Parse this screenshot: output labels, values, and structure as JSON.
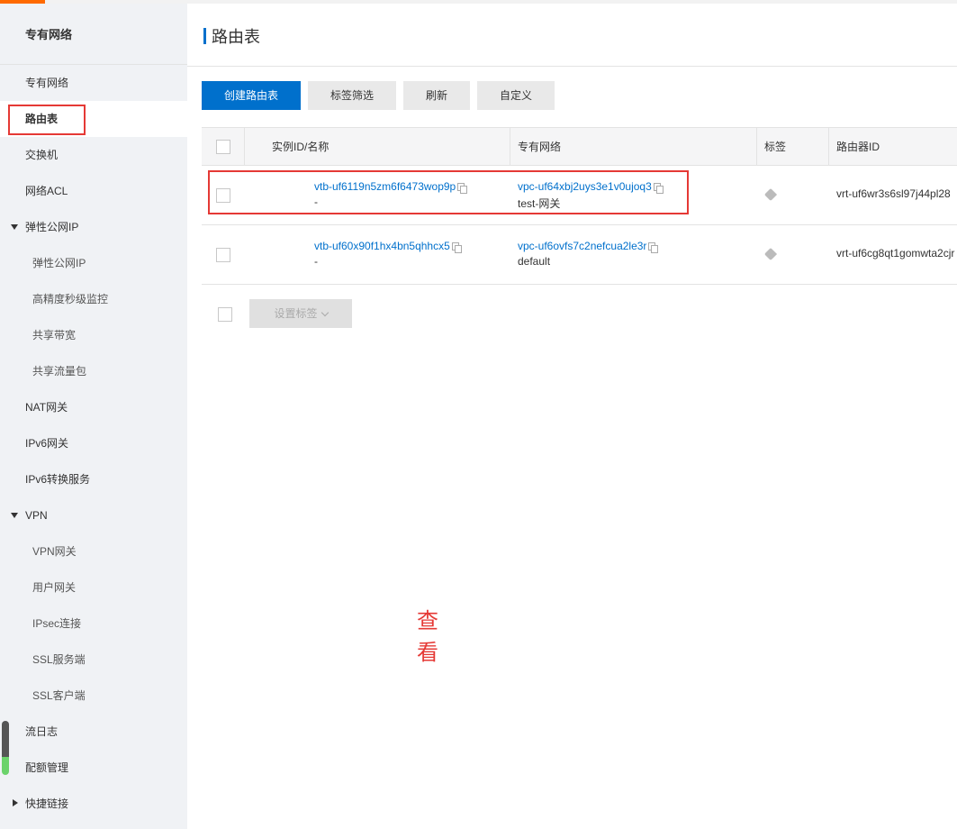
{
  "sidebar": {
    "title": "专有网络",
    "items": [
      {
        "label": "专有网络",
        "type": "item"
      },
      {
        "label": "路由表",
        "type": "item",
        "active": true
      },
      {
        "label": "交换机",
        "type": "item"
      },
      {
        "label": "网络ACL",
        "type": "item"
      },
      {
        "label": "弹性公网IP",
        "type": "group"
      },
      {
        "label": "弹性公网IP",
        "type": "sub"
      },
      {
        "label": "高精度秒级监控",
        "type": "sub"
      },
      {
        "label": "共享带宽",
        "type": "sub"
      },
      {
        "label": "共享流量包",
        "type": "sub"
      },
      {
        "label": "NAT网关",
        "type": "item"
      },
      {
        "label": "IPv6网关",
        "type": "item"
      },
      {
        "label": "IPv6转换服务",
        "type": "item"
      },
      {
        "label": "VPN",
        "type": "group"
      },
      {
        "label": "VPN网关",
        "type": "sub"
      },
      {
        "label": "用户网关",
        "type": "sub"
      },
      {
        "label": "IPsec连接",
        "type": "sub"
      },
      {
        "label": "SSL服务端",
        "type": "sub"
      },
      {
        "label": "SSL客户端",
        "type": "sub"
      },
      {
        "label": "流日志",
        "type": "item"
      },
      {
        "label": "配额管理",
        "type": "item"
      },
      {
        "label": "快捷链接",
        "type": "group-collapsed"
      }
    ]
  },
  "page": {
    "title": "路由表"
  },
  "toolbar": {
    "create_label": "创建路由表",
    "tag_filter_label": "标签筛选",
    "refresh_label": "刷新",
    "customize_label": "自定义"
  },
  "table": {
    "headers": [
      "实例ID/名称",
      "专有网络",
      "标签",
      "路由器ID"
    ],
    "rows": [
      {
        "id": "vtb-uf6119n5zm6f6473wop9p",
        "name": "-",
        "vpc_id": "vpc-uf64xbj2uys3e1v0ujoq3",
        "vpc_name": "test-网关",
        "router_id": "vrt-uf6wr3s6sl97j44pl28"
      },
      {
        "id": "vtb-uf60x90f1hx4bn5qhhcx5",
        "name": "-",
        "vpc_id": "vpc-uf6ovfs7c2nefcua2le3r",
        "vpc_name": "default",
        "router_id": "vrt-uf6cg8qt1gomwta2cjr"
      }
    ]
  },
  "footer": {
    "set_tags_label": "设置标签"
  },
  "annotation": {
    "text": "查看",
    "color": "#e53935"
  },
  "colors": {
    "primary": "#0070cc",
    "highlight_box": "#e53935",
    "brand_accent": "#ff6a00"
  }
}
